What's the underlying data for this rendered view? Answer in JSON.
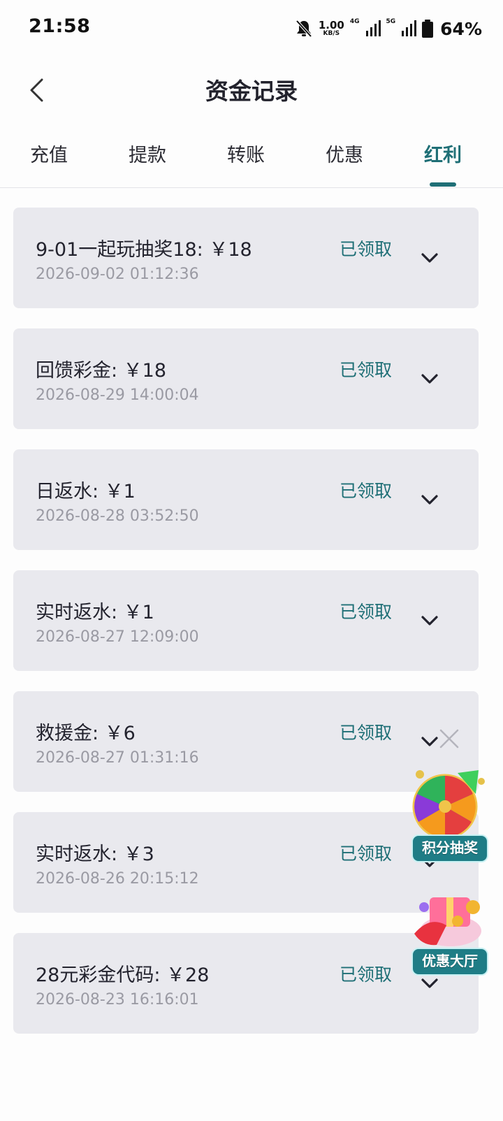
{
  "status_bar": {
    "time": "21:58",
    "speed_value": "1.00",
    "speed_unit": "KB/S",
    "net1": "4G",
    "net2": "5G",
    "battery": "64%"
  },
  "header": {
    "title": "资金记录"
  },
  "tabs": [
    {
      "label": "充值",
      "active": false
    },
    {
      "label": "提款",
      "active": false
    },
    {
      "label": "转账",
      "active": false
    },
    {
      "label": "优惠",
      "active": false
    },
    {
      "label": "红利",
      "active": true
    }
  ],
  "records": [
    {
      "name": "9-01一起玩抽奖18: ￥18",
      "date": "2026-09-02 01:12:36",
      "status": "已领取"
    },
    {
      "name": "回馈彩金: ￥18",
      "date": "2026-08-29 14:00:04",
      "status": "已领取"
    },
    {
      "name": "日返水: ￥1",
      "date": "2026-08-28 03:52:50",
      "status": "已领取"
    },
    {
      "name": "实时返水: ￥1",
      "date": "2026-08-27 12:09:00",
      "status": "已领取"
    },
    {
      "name": "救援金: ￥6",
      "date": "2026-08-27 01:31:16",
      "status": "已领取"
    },
    {
      "name": "实时返水: ￥3",
      "date": "2026-08-26 20:15:12",
      "status": "已领取"
    },
    {
      "name": "28元彩金代码: ￥28",
      "date": "2026-08-23 16:16:01",
      "status": "已领取"
    }
  ],
  "floating": {
    "lottery_label": "积分抽奖",
    "promo_label": "优惠大厅"
  },
  "colors": {
    "accent": "#1f6f76",
    "card_bg": "#e9e9ee",
    "date_text": "#9a9aa3"
  },
  "icons": [
    "back-arrow-icon",
    "chevron-down-icon",
    "close-icon",
    "mute-bell-icon",
    "signal-icon",
    "battery-icon"
  ]
}
